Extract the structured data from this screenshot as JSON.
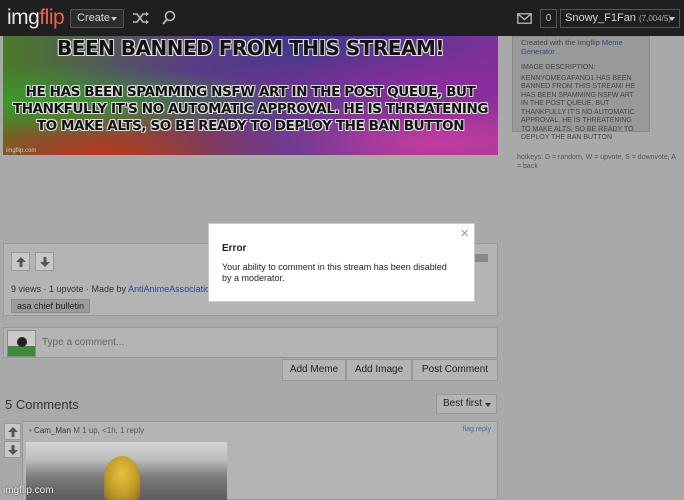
{
  "topbar": {
    "logo_main": "img",
    "logo_accent": "flip",
    "create_label": "Create",
    "notifications": "0",
    "username": "Snowy_F1Fan",
    "user_points": "(7,004/5)"
  },
  "meme": {
    "top_text": "BEEN BANNED FROM THIS STREAM!",
    "bottom_text": "HE HAS BEEN SPAMMING NSFW ART IN THE POST QUEUE, BUT THANKFULLY IT'S NO AUTOMATIC APPROVAL. HE IS THREATENING TO MAKE ALTS, SO BE READY TO DEPLOY THE BAN BUTTON",
    "watermark": "imgflip.com"
  },
  "side": {
    "made_prefix": "Created with the Imgflip",
    "made_link": "Meme Generator",
    "desc_title": "IMAGE DESCRIPTION:",
    "desc": "KENNYOMEGAFANO1 HAS BEEN BANNED FROM THIS STREAM! HE HAS BEEN SPAMMING NSFW ART IN THE POST QUEUE, BUT THANKFULLY IT'S NO AUTOMATIC APPROVAL. HE IS THREATENING TO MAKE ALTS, SO BE READY TO DEPLOY THE BAN BUTTON",
    "hotkeys": "hotkeys: D = random, W = upvote, S = downvote, A = back"
  },
  "post": {
    "stats_prefix": "9 views · 1 upvote · Made by",
    "author": "AntiAnimeAssociation",
    "tag": "asa chief bulletin"
  },
  "comment_form": {
    "placeholder": "Type a comment...",
    "add_meme": "Add Meme",
    "add_image": "Add Image",
    "post_comment": "Post Comment"
  },
  "comments": {
    "title": "5 Comments",
    "sort_label": "Best first",
    "items": [
      {
        "username": "Cam_Man",
        "badge": "M",
        "meta": "1 up, <1h, 1 reply",
        "flag": "flag",
        "reply": "reply"
      }
    ]
  },
  "error": {
    "title": "Error",
    "message": "Your ability to comment in this stream has been disabled by a moderator.",
    "close": "×"
  },
  "watermark": "imgflip.com",
  "colors": {
    "topbar": "#1f1f1f",
    "overlay_bg": "#a9a9a9",
    "logo_accent": "#e8674a",
    "link": "#2b4a8a",
    "modal_bg": "#ffffff"
  }
}
